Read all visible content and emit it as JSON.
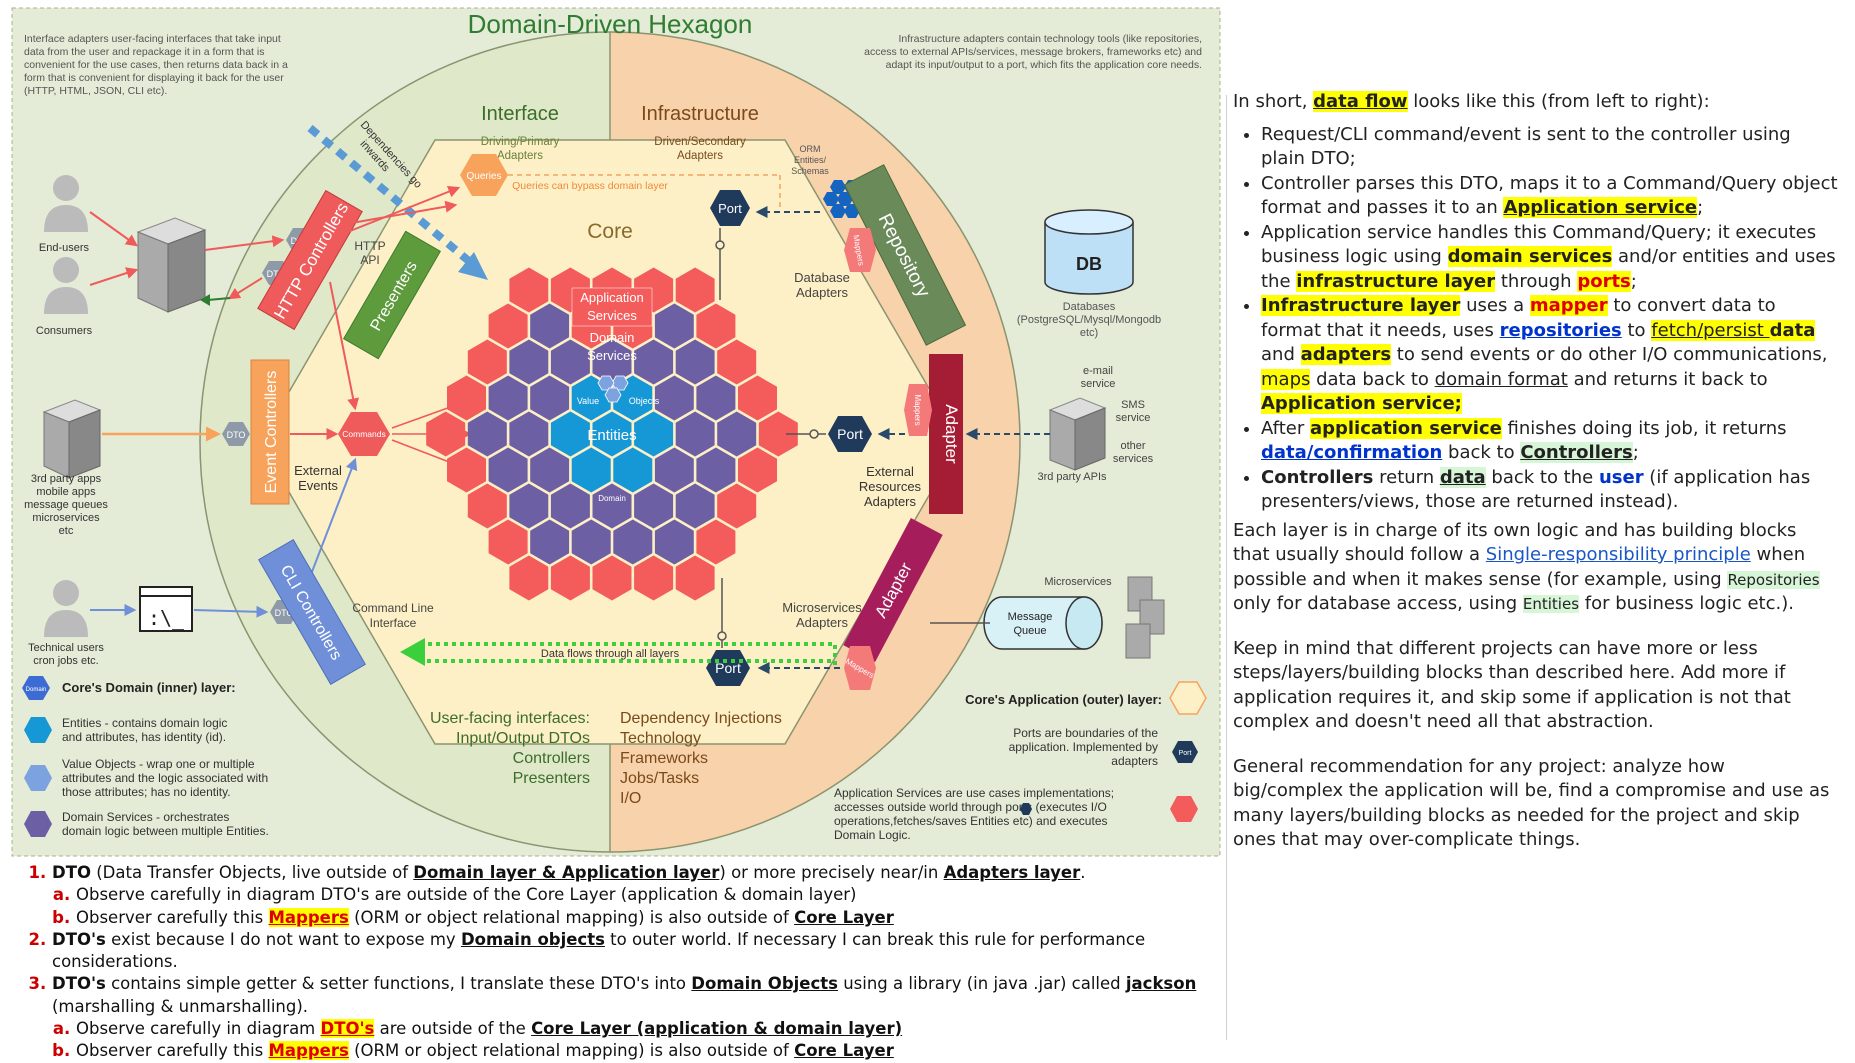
{
  "diagram": {
    "title": "Domain-Driven Hexagon",
    "interface_adapters_note": [
      "Interface adapters user-facing interfaces that take input",
      "data from the user and repackage it in a form that is",
      "convenient for the use cases, then returns data back in a",
      "form that is convenient for displaying it back for the user",
      "(HTTP, HTML, JSON, CLI etc)."
    ],
    "infra_adapters_note": [
      "Infrastructure adapters contain technology tools (like repositories,",
      "access to external APIs/services, message brokers, frameworks etc) and",
      "adapt its input/output to a port, which fits the application core needs."
    ],
    "interface_label": "Interface",
    "driving_adapters": [
      "Driving/Primary",
      "Adapters"
    ],
    "infrastructure_label": "Infrastructure",
    "driven_adapters": [
      "Driven/Secondary",
      "Adapters"
    ],
    "orm_label": [
      "ORM",
      "Entities/",
      "Schemas"
    ],
    "deps_inwards": [
      "Dependencies go",
      "inwards"
    ],
    "queries": "Queries",
    "queries_bypass": "Queries can bypass domain layer",
    "port": "Port",
    "core": "Core",
    "repository": "Repository",
    "mappers": "Mappers",
    "db": "DB",
    "databases": [
      "Databases",
      "(PostgreSQL/Mysql/Mongodb",
      "etc)"
    ],
    "database_adapters": [
      "Database",
      "Adapters"
    ],
    "end_users": "End-users",
    "consumers": "Consumers",
    "dto": "DTO",
    "http_controllers": "HTTP Controllers",
    "http_api": [
      "HTTP",
      "API"
    ],
    "presenters": "Presenters",
    "application_services": [
      "Application",
      "Services"
    ],
    "domain_services": [
      "Domain",
      "Services"
    ],
    "value": "Value",
    "objects": "Objects",
    "entities": "Entities",
    "domain": "Domain",
    "commands": "Commands",
    "event_controllers": "Event Controllers",
    "external_events": [
      "External",
      "Events"
    ],
    "third_party_left": [
      "3rd party apps",
      "mobile apps",
      "message queues",
      "microservices",
      "etc"
    ],
    "adapter": "Adapter",
    "external_resources": [
      "External",
      "Resources",
      "Adapters"
    ],
    "email_service": [
      "e-mail",
      "service"
    ],
    "sms_service": [
      "SMS",
      "service"
    ],
    "other_services": [
      "other",
      "services"
    ],
    "third_party_apis": "3rd party APIs",
    "technical_users": [
      "Technical users",
      "cron jobs etc."
    ],
    "cli_controllers": "CLI Controllers",
    "command_line": [
      "Command Line",
      "Interface"
    ],
    "microservices_adapters": [
      "Microservices",
      "Adapters"
    ],
    "microservices": "Microservices",
    "message_queue": [
      "Message",
      "Queue"
    ],
    "data_flows": "Data flows through all layers",
    "core_domain_layer": "Core's Domain (inner) layer:",
    "core_app_layer": "Core's Application (outer) layer:",
    "legend_entities": [
      "Entities - contains domain logic",
      "and attributes, has identity (id)."
    ],
    "legend_vo": [
      "Value Objects - wrap one or multiple",
      "attributes and the logic associated with",
      "those attributes; has no identity."
    ],
    "legend_ds": [
      "Domain Services - orchestrates",
      "domain logic between multiple Entities."
    ],
    "user_facing": [
      "User-facing interfaces:",
      "Input/Output DTOs",
      "Controllers",
      "Presenters"
    ],
    "di_list": [
      "Dependency Injections",
      "Technology",
      "Frameworks",
      "Jobs/Tasks",
      "I/O"
    ],
    "ports_note": [
      "Ports are boundaries of the",
      "application. Implemented by",
      "adapters"
    ],
    "app_services_note": [
      "Application Services are use cases implementations;",
      "accesses outside world through     ports (executes I/O",
      "operations,fetches/saves Entities etc) and executes",
      "Domain Logic."
    ],
    "colors": {
      "bg": "#e4ebd6",
      "left_half": "#dfe9c9",
      "right_half": "#f8d2ab",
      "core": "#fdf0c6",
      "red": "#f45b5b",
      "purple": "#6d5fa4",
      "blue": "#1697d6",
      "navy": "#1f3a5a",
      "accent_orange": "#f7a35c"
    }
  },
  "right_panel": {
    "intro_a": "In short, ",
    "intro_hl": "data flow",
    "intro_b": " looks like this (from left to right):",
    "b1": "Request/CLI command/event is sent to the controller using plain DTO;",
    "b2a": "Controller parses this DTO, maps it to a Command/Query object format and passes it to an ",
    "b2hl": "Application service",
    "b2b": ";",
    "b3a": "Application service handles this Command/Query; it executes business logic using ",
    "b3hl1": "domain services",
    "b3b": " and/or entities and uses the ",
    "b3hl2": "infrastructure layer",
    "b3c": " through ",
    "b3hl3": "ports",
    "b3d": ";",
    "b4hl1": "Infrastructure layer",
    "b4a": " uses a ",
    "b4hl2": "mapper",
    "b4b": " to convert data to format that it needs, uses ",
    "b4hl3": "repositories",
    "b4c": " to ",
    "b4hl4": "fetch/persist ",
    "b4hl4b": "data",
    "b4d": " and ",
    "b4hl5": "adapters",
    "b4e": " to send events or do other I/O communications, ",
    "b4hl6": "maps",
    "b4f": " data back to ",
    "b4hl7": "domain format",
    "b4g": " and returns it back to ",
    "b4hl8": "Application service;",
    "b5a": "After ",
    "b5hl1": "application service",
    "b5b": " finishes doing its job, it returns ",
    "b5hl2": "data/confirmation",
    "b5c": " back to ",
    "b5hl3": "Controllers",
    "b5d": ";",
    "b6a": "Controllers",
    "b6b": " return ",
    "b6hl": "data",
    "b6c": " back to the ",
    "b6hl2": "user",
    "b6d": " (if application has presenters/views, those are returned instead).",
    "p1a": "Each layer is in charge of its own logic and has building blocks that usually should follow a ",
    "p1link": "Single-responsibility principle",
    "p1b": " when possible and when it makes sense (for example, using ",
    "p1hl1": "Repositories",
    "p1c": " only for database access, using ",
    "p1hl2": "Entities",
    "p1d": " for business logic etc.).",
    "p2": "Keep in mind that different projects can have more or less steps/layers/building blocks than described here. Add more if application requires it, and skip some if application is not that complex and doesn't need all that abstraction.",
    "p3": "General recommendation for any project: analyze how big/complex the application will be, find a compromise and use as many layers/building blocks as needed for the project and skip ones that may over-complicate things."
  },
  "bottom_notes": {
    "n1a": "DTO",
    "n1b": " (Data Transfer Objects, live outside of ",
    "n1c": "Domain layer & Application layer",
    "n1d": ") or more precisely near/in ",
    "n1e": "Adapters layer",
    "n1f": ".",
    "n1_a": "Observe carefully in diagram DTO's are outside of the Core Layer (application & domain layer)",
    "n1_b1": "Observer carefully this ",
    "n1_b2": "Mappers",
    "n1_b3": " (ORM or object relational mapping) is also outside of ",
    "n1_b4": "Core Layer",
    "n2a": "DTO's",
    "n2b": " exist because I do not want to expose my ",
    "n2c": "Domain objects",
    "n2d": " to outer world. If necessary I can break this rule for performance considerations.",
    "n3a": "DTO's",
    "n3b": " contains simple getter & setter functions, I translate these DTO's into ",
    "n3c": "Domain Objects",
    "n3d": " using a library (in java .jar) called ",
    "n3e": "jackson",
    "n3f": " (marshalling & unmarshalling).",
    "n3_a1": "Observe carefully in diagram ",
    "n3_a2": "DTO's",
    "n3_a3": " are outside of the ",
    "n3_a4": "Core Layer (application & domain layer)",
    "n3_b1": "Observer carefully this ",
    "n3_b2": "Mappers",
    "n3_b3": " (ORM or object relational mapping) is also outside of ",
    "n3_b4": "Core Layer"
  }
}
